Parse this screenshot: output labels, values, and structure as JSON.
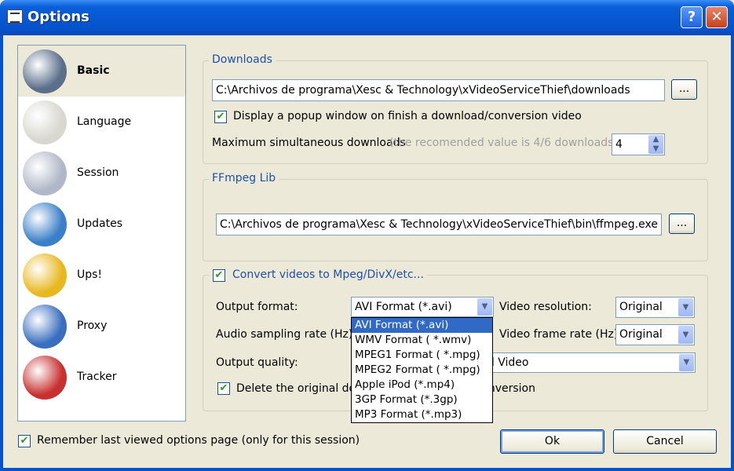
{
  "window": {
    "title": "Options",
    "help_label": "?",
    "close_label": "✕"
  },
  "sidebar": {
    "items": [
      {
        "label": "Basic",
        "icon": "hammer-icon",
        "color": "#5b6f8a"
      },
      {
        "label": "Language",
        "icon": "scroll-icon",
        "color": "#d8d8d0"
      },
      {
        "label": "Session",
        "icon": "pen-paper-icon",
        "color": "#b0b8c8"
      },
      {
        "label": "Updates",
        "icon": "globe-update-icon",
        "color": "#3a7fc8"
      },
      {
        "label": "Ups!",
        "icon": "shield-icon",
        "color": "#e8b820"
      },
      {
        "label": "Proxy",
        "icon": "globe-network-icon",
        "color": "#3a6fc0"
      },
      {
        "label": "Tracker",
        "icon": "ladybug-icon",
        "color": "#c83030"
      }
    ]
  },
  "downloads": {
    "title": "Downloads",
    "path": "C:\\Archivos de programa\\Xesc & Technology\\xVideoServiceThief\\downloads",
    "browse_label": "...",
    "popup_label": "Display a popup window on finish a download/conversion video",
    "max_label": "Maximum simultaneous downloads",
    "max_hint": "(the recomended value is 4/6 downloads)",
    "max_value": "4"
  },
  "ffmpeg": {
    "title": "FFmpeg Lib",
    "path": "C:\\Archivos de programa\\Xesc & Technology\\xVideoServiceThief\\bin\\ffmpeg.exe",
    "browse_label": "..."
  },
  "convert": {
    "title": "Convert videos to Mpeg/DivX/etc...",
    "output_format_label": "Output format:",
    "output_format_value": "AVI Format (*.avi)",
    "video_resolution_label": "Video resolution:",
    "video_resolution_value": "Original",
    "audio_rate_label": "Audio sampling rate (Hz):",
    "frame_rate_label": "Video frame rate (Hz)",
    "frame_rate_value": "Original",
    "quality_label": "Output quality:",
    "quality_value": "Original Video",
    "delete_label": "Delete the original downloaded video after conversion",
    "format_options": [
      "AVI Format (*.avi)",
      "WMV Format ( *.wmv)",
      "MPEG1 Format ( *.mpg)",
      "MPEG2 Format ( *.mpg)",
      "Apple iPod (*.mp4)",
      "3GP Format (*.3gp)",
      "MP3 Format (*.mp3)"
    ]
  },
  "footer": {
    "remember_label": "Remember last viewed options page (only for this session)",
    "ok_label": "Ok",
    "cancel_label": "Cancel"
  }
}
